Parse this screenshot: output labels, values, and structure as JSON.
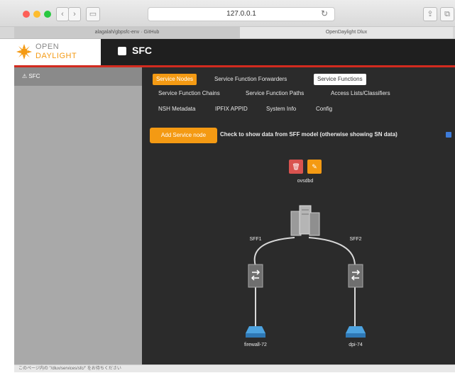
{
  "browser": {
    "url": "127.0.0.1",
    "tabs": [
      "alagalah/gbpsfc-env · GitHub",
      "OpenDaylight Dlux"
    ],
    "status_text": "このページ内の \"/dlux/services/sfc/\" をお待ちください"
  },
  "header": {
    "logo_line1": "OPEN",
    "logo_line2": "DAYLIGHT",
    "app_title": "SFC"
  },
  "sidebar": {
    "items": [
      {
        "label": "SFC"
      }
    ]
  },
  "nav": {
    "row1": [
      "Service Nodes",
      "Service Function Forwarders",
      "Service Functions"
    ],
    "row2": [
      "Service Function Chains",
      "Service Function Paths",
      "Access Lists/Classifiers"
    ],
    "row3": [
      "NSH Metadata",
      "IPFIX APPID",
      "System Info",
      "Config"
    ],
    "active": "Service Nodes"
  },
  "toolbar": {
    "add_label": "Add Service node",
    "check_label": "Check to show data from SFF model (otherwise showing SN data)",
    "checked": true
  },
  "topology": {
    "root_node": "ovsdbd",
    "action_delete": "🗑",
    "action_edit": "✎",
    "forwarders": [
      {
        "label": "SFF1",
        "sf": "firewall-72"
      },
      {
        "label": "SFF2",
        "sf": "dpi-74"
      }
    ]
  }
}
